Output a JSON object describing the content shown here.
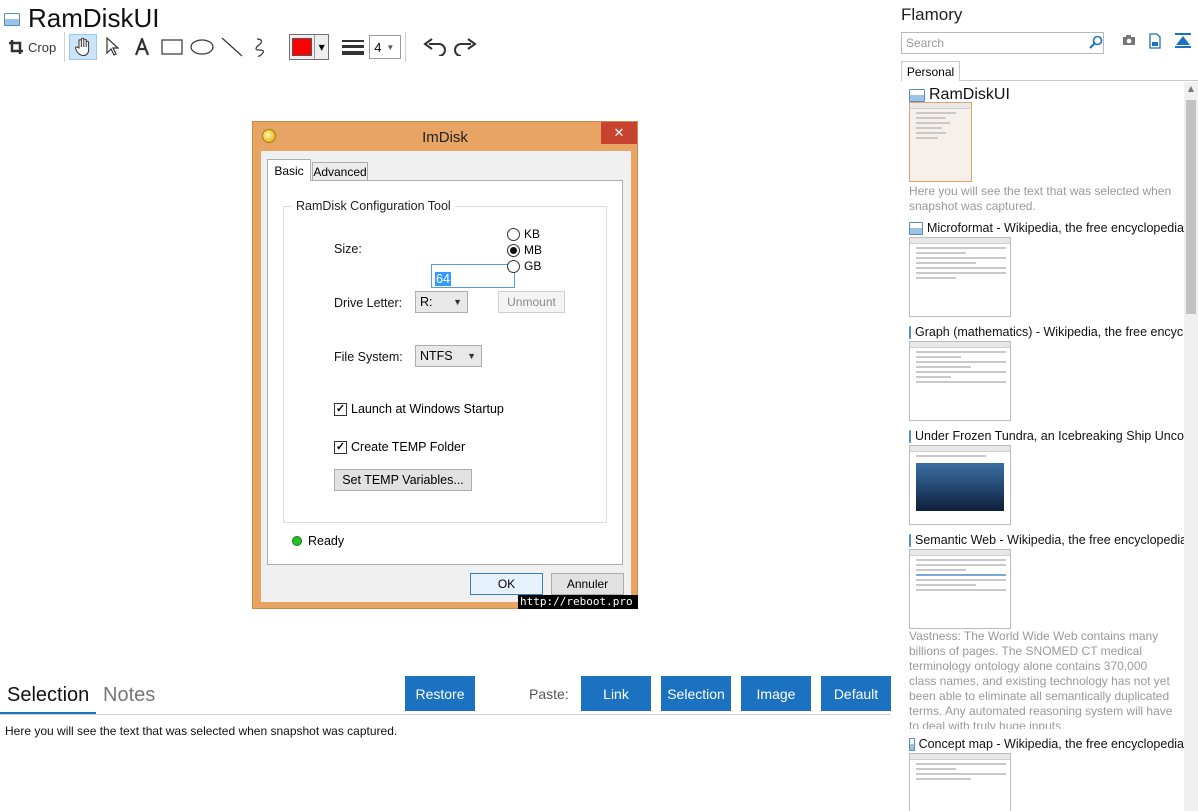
{
  "app": {
    "title": "RamDiskUI",
    "toolbar": {
      "crop_label": "Crop",
      "color_hex": "#ff0000",
      "line_width": "4",
      "icons": [
        "crop-icon",
        "hand-icon",
        "pointer-icon",
        "text-icon",
        "rectangle-icon",
        "ellipse-icon",
        "line-icon",
        "freehand-icon",
        "color-icon",
        "line-width-icon",
        "undo-icon",
        "redo-icon"
      ]
    }
  },
  "dialog": {
    "title": "ImDisk",
    "close_glyph": "✕",
    "tabs": [
      "Basic",
      "Advanced"
    ],
    "group_title": "RamDisk Configuration Tool",
    "size_label": "Size:",
    "size_value": "64",
    "units": [
      "KB",
      "MB",
      "GB"
    ],
    "unit_selected": "MB",
    "drive_letter_label": "Drive Letter:",
    "drive_letter_value": "R:",
    "unmount_label": "Unmount",
    "file_system_label": "File System:",
    "file_system_value": "NTFS",
    "launch_label": "Launch at Windows Startup",
    "launch_checked": true,
    "create_temp_label": "Create TEMP Folder",
    "create_temp_checked": true,
    "set_temp_label": "Set TEMP Variables...",
    "status": "Ready",
    "ok_label": "OK",
    "cancel_label": "Annuler",
    "watermark": "http://reboot.pro",
    "check_glyph": "✓"
  },
  "bottom": {
    "tabs": [
      "Selection",
      "Notes"
    ],
    "restore_label": "Restore",
    "paste_label": "Paste:",
    "paste_buttons": [
      "Link",
      "Selection",
      "Image",
      "Default"
    ],
    "selection_text": "Here you will see the text that was selected when snapshot was captured.",
    "accent": "#1a72c1"
  },
  "sidebar": {
    "brand": "Flamory",
    "search_placeholder": "Search",
    "folder_tab": "Personal",
    "items": [
      {
        "title": "RamDiskUI",
        "desc": "Here you will see the text that was selected when snapshot was captured."
      },
      {
        "title": "Microformat - Wikipedia, the free encyclopedia",
        "desc": ""
      },
      {
        "title": "Graph (mathematics) - Wikipedia, the free encyclopedia",
        "desc": ""
      },
      {
        "title": "Under Frozen Tundra, an Icebreaking Ship Uncovers",
        "desc": ""
      },
      {
        "title": "Semantic Web - Wikipedia, the free encyclopedia",
        "desc": "Vastness: The World Wide Web contains many billions of pages. The SNOMED CT medical terminology ontology alone contains 370,000 class names, and existing technology has not yet been able to eliminate all semantically duplicated terms. Any automated reasoning system will have to deal with truly huge inputs."
      },
      {
        "title": "Concept map - Wikipedia, the free encyclopedia",
        "desc": ""
      }
    ]
  }
}
